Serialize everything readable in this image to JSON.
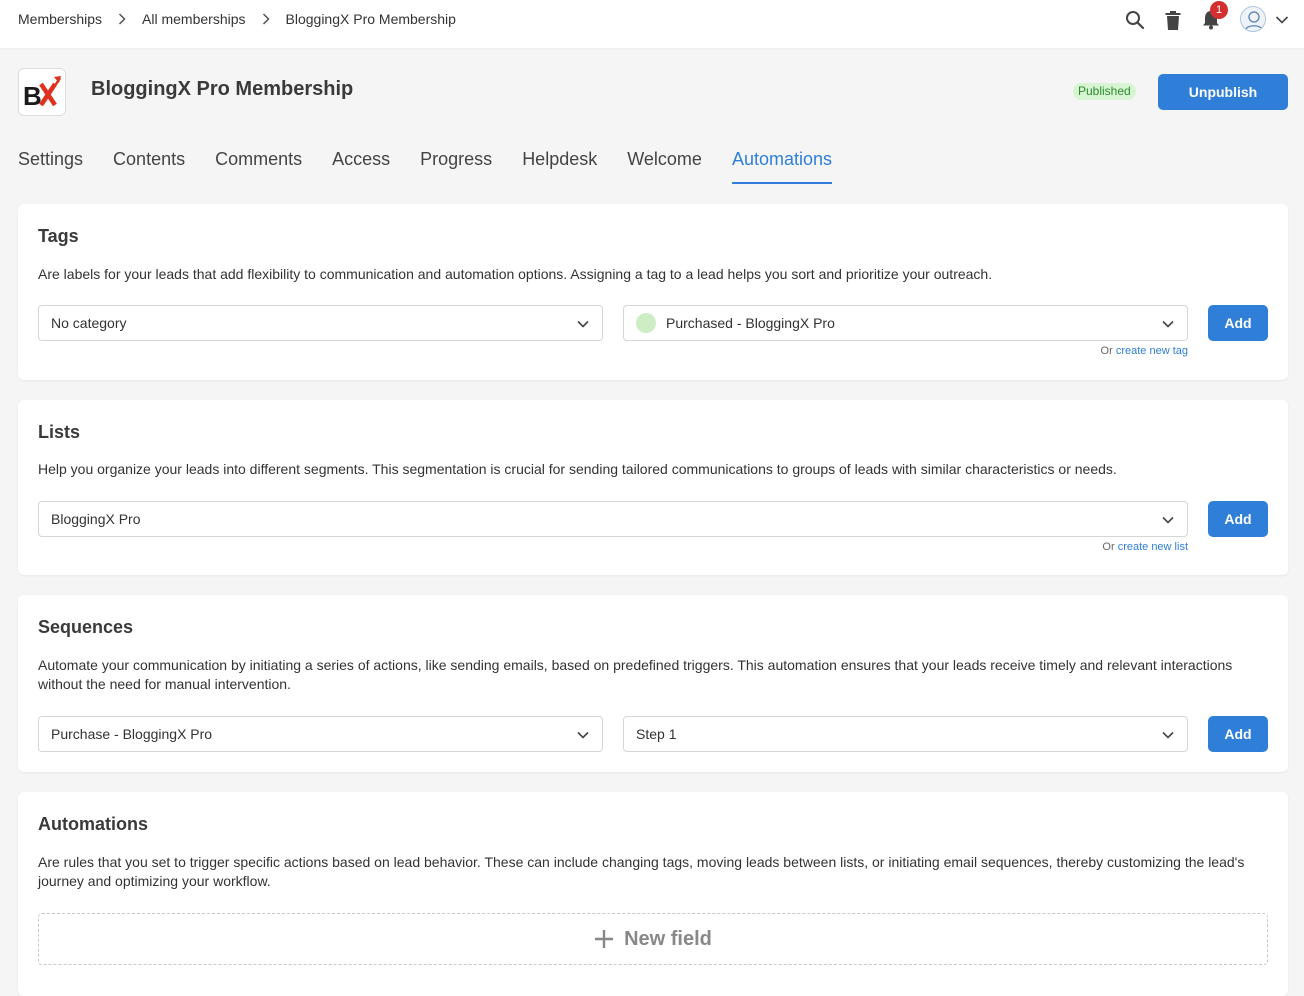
{
  "breadcrumb": [
    "Memberships",
    "All memberships",
    "BloggingX Pro Membership"
  ],
  "top": {
    "notification_count": "1"
  },
  "header": {
    "logo_text": "BX",
    "title": "BloggingX Pro Membership",
    "status": "Published",
    "unpublish_label": "Unpublish"
  },
  "tabs": [
    "Settings",
    "Contents",
    "Comments",
    "Access",
    "Progress",
    "Helpdesk",
    "Welcome",
    "Automations"
  ],
  "active_tab": "Automations",
  "tags": {
    "title": "Tags",
    "description": "Are labels for your leads that add flexibility to communication and automation options. Assigning a tag to a lead helps you sort and prioritize your outreach.",
    "category_value": "No category",
    "tag_value": "Purchased - BloggingX Pro",
    "add_label": "Add",
    "create_prefix": "Or",
    "create_link": "create new tag"
  },
  "lists": {
    "title": "Lists",
    "description": "Help you organize your leads into different segments. This segmentation is crucial for sending tailored communications to groups of leads with similar characteristics or needs.",
    "list_value": "BloggingX Pro",
    "add_label": "Add",
    "create_prefix": "Or",
    "create_link": "create new list"
  },
  "sequences": {
    "title": "Sequences",
    "description": "Automate your communication by initiating a series of actions, like sending emails, based on predefined triggers. This automation ensures that your leads receive timely and relevant interactions without the need for manual intervention.",
    "sequence_value": "Purchase - BloggingX Pro",
    "step_value": "Step 1",
    "add_label": "Add"
  },
  "automations": {
    "title": "Automations",
    "description": "Are rules that you set to trigger specific actions based on lead behavior. These can include changing tags, moving leads between lists, or initiating email sequences, thereby customizing the lead's journey and optimizing your workflow.",
    "new_field_label": "New field"
  },
  "colors": {
    "accent": "#2f7fd9",
    "published_bg": "#d7f5d3",
    "published_text": "#2e8b2e",
    "badge": "#d32f2f"
  }
}
